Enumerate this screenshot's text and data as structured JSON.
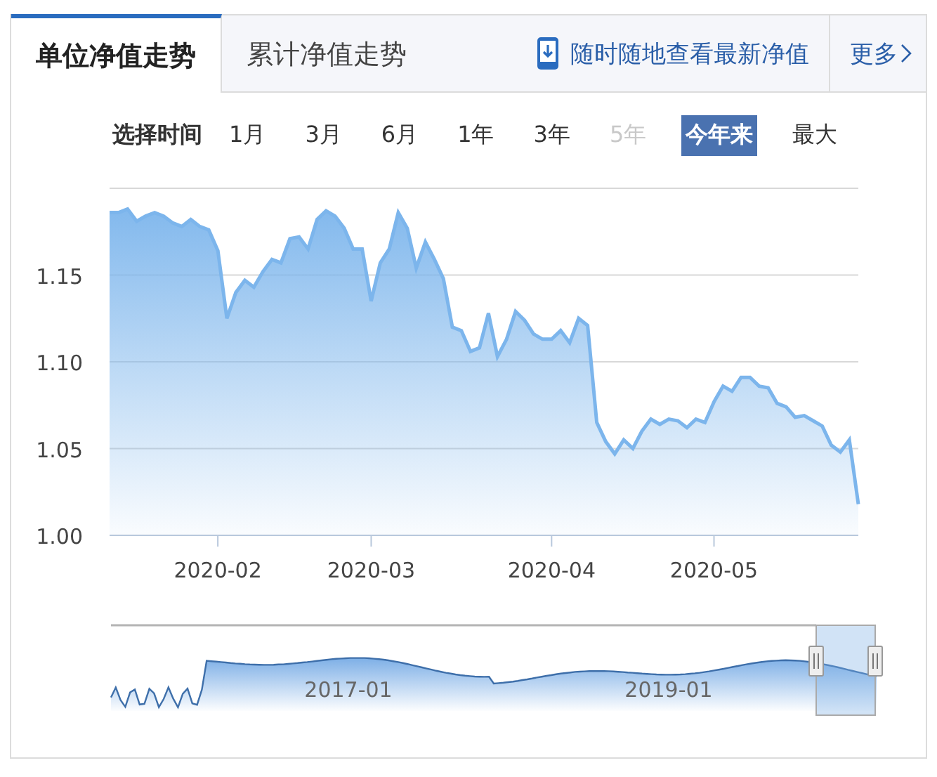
{
  "tabs": [
    {
      "label": "单位净值走势",
      "selected": true
    },
    {
      "label": "累计净值走势",
      "selected": false
    }
  ],
  "app_link": {
    "label": "随时随地查看最新净值"
  },
  "more_link": {
    "label": "更多"
  },
  "period_selector": {
    "label": "选择时间",
    "options": [
      {
        "label": "1月",
        "selected": false,
        "disabled": false
      },
      {
        "label": "3月",
        "selected": false,
        "disabled": false
      },
      {
        "label": "6月",
        "selected": false,
        "disabled": false
      },
      {
        "label": "1年",
        "selected": false,
        "disabled": false
      },
      {
        "label": "3年",
        "selected": false,
        "disabled": false
      },
      {
        "label": "5年",
        "selected": false,
        "disabled": true
      },
      {
        "label": "今年来",
        "selected": true,
        "disabled": false
      },
      {
        "label": "最大",
        "selected": false,
        "disabled": false
      }
    ]
  },
  "chart": {
    "chart_data": {
      "type": "area",
      "categories": [
        null,
        null,
        null,
        null,
        null,
        null,
        null,
        null,
        null,
        null,
        null,
        null,
        "2020-02",
        null,
        null,
        null,
        null,
        null,
        null,
        null,
        null,
        null,
        null,
        null,
        null,
        null,
        null,
        null,
        null,
        "2020-03",
        null,
        null,
        null,
        null,
        null,
        null,
        null,
        null,
        null,
        null,
        null,
        null,
        null,
        null,
        null,
        null,
        null,
        null,
        null,
        "2020-04",
        null,
        null,
        null,
        null,
        null,
        null,
        null,
        null,
        null,
        null,
        null,
        null,
        null,
        null,
        null,
        null,
        null,
        "2020-05",
        null,
        null,
        null,
        null,
        null,
        null,
        null,
        null,
        null,
        null,
        null,
        null,
        null,
        null,
        null,
        null
      ],
      "series": [
        {
          "color": "#7cb5ec",
          "values": [
            1.186,
            1.186,
            1.188,
            1.181,
            1.184,
            1.186,
            1.184,
            1.18,
            1.178,
            1.182,
            1.178,
            1.176,
            1.164,
            1.125,
            1.14,
            1.147,
            1.143,
            1.152,
            1.159,
            1.157,
            1.171,
            1.172,
            1.165,
            1.182,
            1.187,
            1.184,
            1.177,
            1.165,
            1.165,
            1.135,
            1.157,
            1.165,
            1.186,
            1.177,
            1.154,
            1.169,
            1.159,
            1.148,
            1.12,
            1.118,
            1.106,
            1.108,
            1.128,
            1.103,
            1.113,
            1.129,
            1.124,
            1.116,
            1.113,
            1.113,
            1.118,
            1.111,
            1.125,
            1.121,
            1.065,
            1.054,
            1.047,
            1.055,
            1.05,
            1.06,
            1.067,
            1.064,
            1.067,
            1.066,
            1.062,
            1.067,
            1.065,
            1.077,
            1.086,
            1.083,
            1.091,
            1.091,
            1.086,
            1.085,
            1.076,
            1.074,
            1.068,
            1.069,
            1.066,
            1.063,
            1.052,
            1.048,
            1.055,
            1.018
          ]
        }
      ],
      "ylim": [
        1.0,
        1.2
      ],
      "grid": true,
      "yticks": [
        {
          "value": 1.0,
          "label": "1.00"
        },
        {
          "value": 1.05,
          "label": "1.05"
        },
        {
          "value": 1.1,
          "label": "1.10"
        },
        {
          "value": 1.15,
          "label": "1.15"
        }
      ]
    }
  },
  "navigator": {
    "labels": [
      "2017-01",
      "2019-01"
    ]
  }
}
